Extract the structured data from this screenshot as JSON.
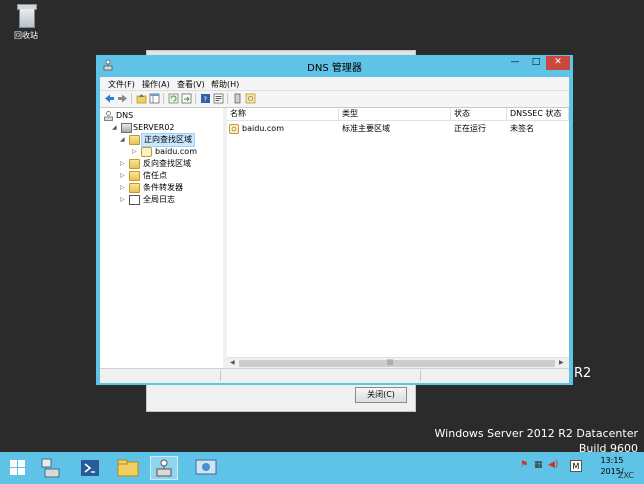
{
  "desktop": {
    "recycle_bin_label": "回收站",
    "brand_line1": "Windows Server 2012 R2 Datacenter",
    "brand_line2": "Build 9600",
    "behind_text": "R2"
  },
  "background_dialog": {
    "close_button": "关闭(C)"
  },
  "window": {
    "title": "DNS 管理器",
    "controls": {
      "minimize": "—",
      "maximize": "□",
      "close": "✕"
    },
    "menu": [
      "文件(F)",
      "操作(A)",
      "查看(V)",
      "帮助(H)"
    ]
  },
  "tree": {
    "root": "DNS",
    "server": "SERVER02",
    "forward_zones": "正向查找区域",
    "zone": "baidu.com",
    "reverse_zones": "反向查找区域",
    "trust_points": "信任点",
    "conditional_forwarders": "条件转发器",
    "global_logs": "全局日志"
  },
  "list": {
    "columns": [
      "名称",
      "类型",
      "状态",
      "DNSSEC 状态"
    ],
    "rows": [
      {
        "name": "baidu.com",
        "type": "标准主要区域",
        "status": "正在运行",
        "dnssec": "未签名"
      }
    ]
  },
  "taskbar": {
    "clock_time": "13:15",
    "clock_date": "2015/",
    "ime_label": "M",
    "ime_lang": "ZXC"
  },
  "colors": {
    "accent": "#5ec3e6",
    "desktop": "#2b2b2b",
    "close": "#c9473c",
    "selection": "#cce8ff"
  }
}
